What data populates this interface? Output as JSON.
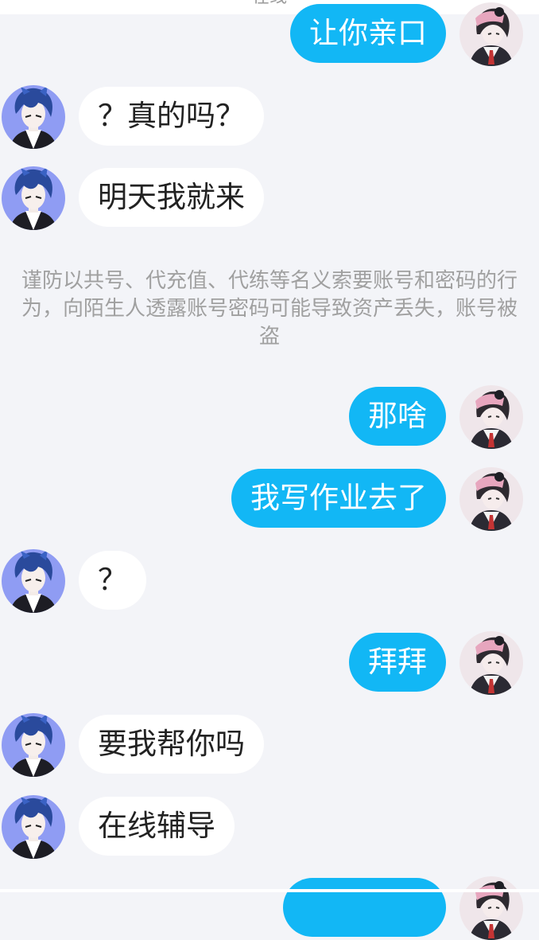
{
  "header": {
    "status_text": "在线"
  },
  "notice": "谨防以共号、代充值、代练等名义索要账号和密码的行为，向陌生人透露账号密码可能导致资产丢失，账号被盗",
  "messages": [
    {
      "side": "right",
      "text": "让你亲口",
      "avatar": "girl-avatar"
    },
    {
      "side": "left",
      "text": "？真的吗？",
      "avatar": "boy-avatar"
    },
    {
      "side": "left",
      "text": "明天我就来",
      "avatar": "boy-avatar"
    },
    {
      "side": "right",
      "text": "那啥",
      "avatar": "girl-avatar"
    },
    {
      "side": "right",
      "text": "我写作业去了",
      "avatar": "girl-avatar"
    },
    {
      "side": "left",
      "text": "？",
      "avatar": "boy-avatar"
    },
    {
      "side": "right",
      "text": "拜拜",
      "avatar": "girl-avatar"
    },
    {
      "side": "left",
      "text": "要我帮你吗",
      "avatar": "boy-avatar"
    },
    {
      "side": "left",
      "text": "在线辅导",
      "avatar": "boy-avatar"
    },
    {
      "side": "right",
      "text": "",
      "avatar": "girl-avatar"
    }
  ],
  "colors": {
    "background": "#f3f4f8",
    "outgoing_bubble": "#12b7f5",
    "incoming_bubble": "#ffffff",
    "notice_text": "#a0a0a0"
  }
}
